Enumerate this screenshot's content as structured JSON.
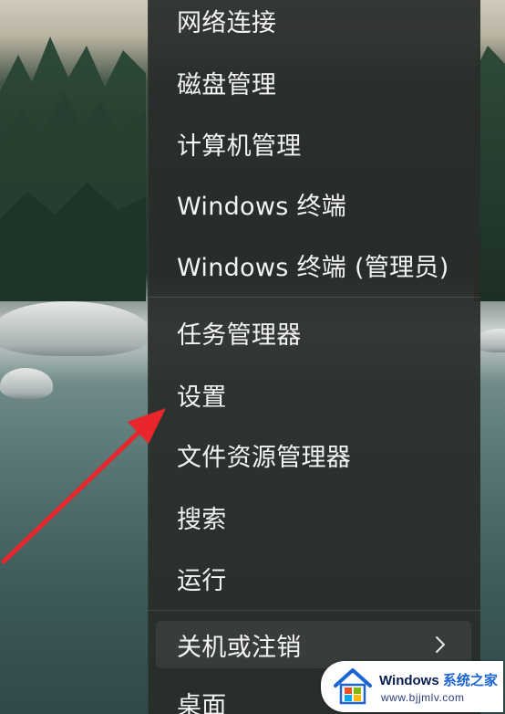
{
  "context_menu": {
    "items": [
      {
        "label": "网络连接"
      },
      {
        "label": "磁盘管理"
      },
      {
        "label": "计算机管理"
      },
      {
        "label": "Windows 终端"
      },
      {
        "label": "Windows 终端 (管理员)"
      },
      {
        "label": "任务管理器"
      },
      {
        "label": "设置"
      },
      {
        "label": "文件资源管理器"
      },
      {
        "label": "搜索"
      },
      {
        "label": "运行"
      },
      {
        "label": "关机或注销",
        "has_submenu": true,
        "submenu_icon": "chevron-right-icon"
      },
      {
        "label": "桌面"
      }
    ]
  },
  "annotation": {
    "type": "arrow",
    "color": "#e8262b",
    "points_to": "设置"
  },
  "watermark": {
    "brand_text": "Windows",
    "brand_accent": "系统之家",
    "url": "www.bjjmlv.com",
    "logo_icon": "house-logo-icon"
  },
  "colors": {
    "menu_background": "#2c2f2d",
    "menu_text": "#f4f4f4",
    "arrow": "#e8262b",
    "watermark_brand": "#0b1e52",
    "watermark_accent": "#1a64d6"
  }
}
